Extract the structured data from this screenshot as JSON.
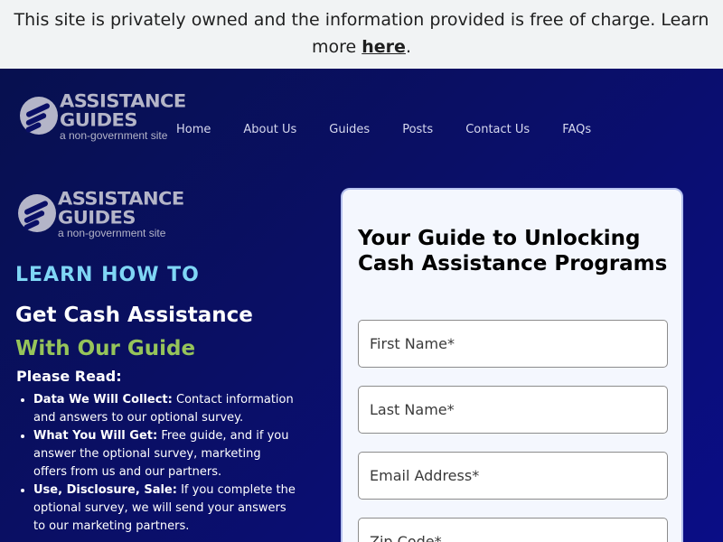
{
  "notice": {
    "text": "This site is privately owned and the information provided is free of charge. Learn more",
    "link": "here",
    "end": "."
  },
  "logo": {
    "line1": "ASSISTANCE",
    "line2": "GUIDES",
    "tagline": "a non-government site"
  },
  "nav": {
    "items": [
      "Home",
      "About Us",
      "Guides",
      "Posts",
      "Contact Us",
      "FAQs"
    ]
  },
  "left": {
    "eyebrow": "LEARN HOW TO",
    "headline1": "Get Cash Assistance",
    "headline2": "With Our Guide",
    "read_heading": "Please Read:",
    "bullets": [
      {
        "label": "Data We Will Collect:",
        "text": " Contact information and answers to our optional survey."
      },
      {
        "label": "What You Will Get:",
        "text": " Free guide, and if you answer the optional survey, marketing offers from us and our partners."
      },
      {
        "label": "Use, Disclosure, Sale:",
        "text": " If you complete the optional survey, we will send your answers to our marketing partners."
      }
    ]
  },
  "form": {
    "title": "Your Guide to Unlocking Cash Assistance Programs",
    "first_name_placeholder": "First Name*",
    "last_name_placeholder": "Last Name*",
    "email_placeholder": "Email Address*",
    "zip_placeholder": "Zip Code*"
  },
  "colors": {
    "hero_bg": "#0a0f66",
    "eyebrow": "#7fd6f5",
    "accent_green": "#96c45a",
    "card_border": "#b4c0ee"
  }
}
